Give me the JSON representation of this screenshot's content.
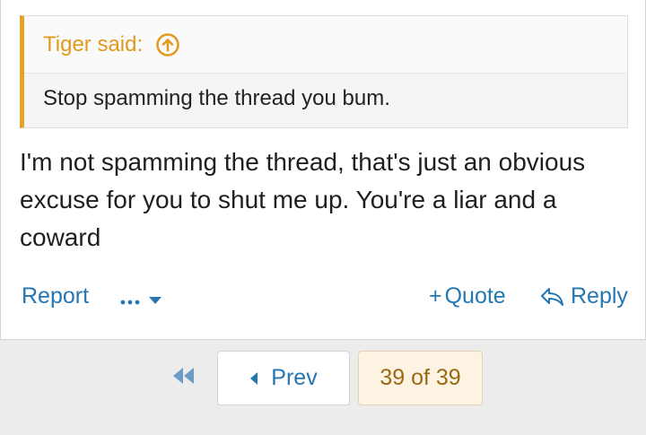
{
  "quote": {
    "author_text": "Tiger said:",
    "body": "Stop spamming the thread you bum."
  },
  "message": {
    "text": "I'm not spamming the thread, that's just an obvious excuse for you to shut me up. You're a liar and a coward"
  },
  "actions": {
    "report": "Report",
    "more": "•••",
    "quote": "Quote",
    "quote_prefix": "+",
    "reply": "Reply"
  },
  "pagination": {
    "prev": "Prev",
    "page_status": "39 of 39"
  },
  "icons": {
    "goto": "arrow-up-circle-icon",
    "more": "ellipsis-icon",
    "dropdown": "caret-down-icon",
    "reply": "reply-arrow-icon",
    "first": "double-chevron-left-icon",
    "prev": "caret-left-icon"
  },
  "colors": {
    "accent": "#e09a1e",
    "link": "#2577b1",
    "page_bg": "#fdf3e3"
  }
}
